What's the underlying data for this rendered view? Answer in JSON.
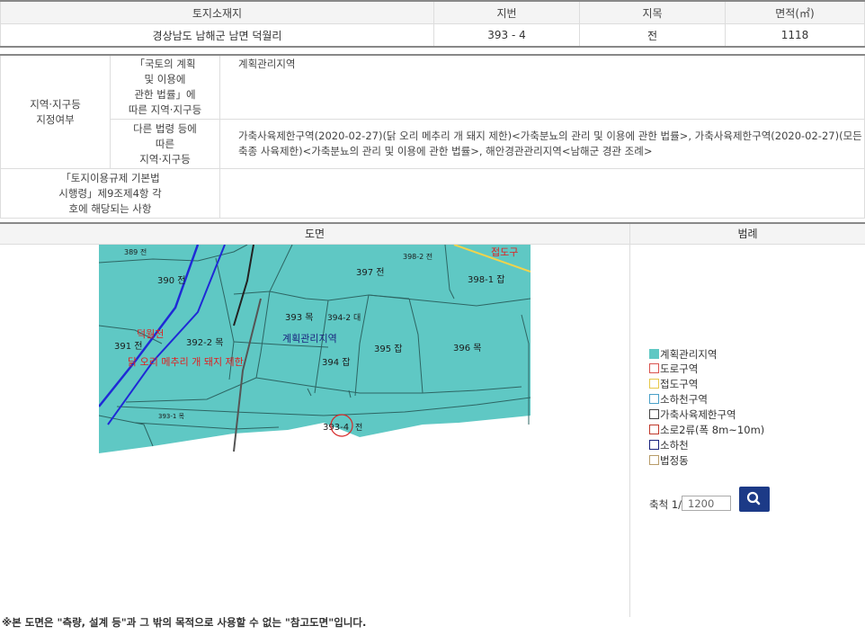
{
  "land_table": {
    "headers": [
      "토지소재지",
      "지번",
      "지목",
      "면적(㎡)"
    ],
    "row": [
      "경상남도 남해군 남면 덕월리",
      "393 - 4",
      "전",
      "1118"
    ]
  },
  "zoning": {
    "section_label": "지역·지구등\n지정여부",
    "national_act_label": "「국토의 계획\n및 이용에\n관한 법률」에\n따른 지역·지구등",
    "national_act_value": "계획관리지역",
    "other_laws_label": "다른 법령 등에\n따른\n지역·지구등",
    "other_laws_value": "가축사육제한구역(2020-02-27)(닭 오리 메추리 개 돼지 제한)<가축분뇨의 관리 및 이용에 관한 법률>, 가축사육제한구역(2020-02-27)(모든축종 사육제한)<가축분뇨의 관리 및 이용에 관한 법률>, 해안경관관리지역<남해군 경관 조례>",
    "decree_label": "「토지이용규제 기본법\n시행령」제9조제4항 각\n호에 해당되는 사항",
    "decree_value": ""
  },
  "map_section": {
    "map_header": "도면",
    "legend_header": "범례",
    "map_labels": {
      "p389": "389 전",
      "p390": "390 전",
      "p397": "397 전",
      "p398_2": "398-2 전",
      "p398_1": "398-1 잡",
      "p393": "393 목",
      "p394_2": "394-2 대",
      "p391": "391 전",
      "p392_2": "392-2 목",
      "p395": "395 잡",
      "p396": "396 목",
      "p394": "394 잡",
      "p393_1": "393-1 목",
      "p393_4": "393-4",
      "p393_4_use": "전",
      "zone": "계획관리지역",
      "stream": "덕월천",
      "restriction": "닭 오리 메추리 개 돼지 제한",
      "road": "접도구"
    },
    "legend_items": [
      {
        "label": "계획관리지역",
        "color": "#5fc8c4",
        "fill": true
      },
      {
        "label": "도로구역",
        "color": "#d9534f",
        "fill": false
      },
      {
        "label": "접도구역",
        "color": "#e6c84a",
        "fill": false
      },
      {
        "label": "소하천구역",
        "color": "#4aa0c8",
        "fill": false
      },
      {
        "label": "가축사육제한구역",
        "color": "#444444",
        "fill": false
      },
      {
        "label": "소로2류(폭 8m~10m)",
        "color": "#c0392b",
        "fill": false
      },
      {
        "label": "소하천",
        "color": "#1a237e",
        "fill": false
      },
      {
        "label": "법정동",
        "color": "#b89c6a",
        "fill": false
      }
    ],
    "scale_label": "축척 1/",
    "scale_value": "1200",
    "search_icon": "search-icon"
  },
  "footer_note": "※본 도면은 \"측량, 설계 등\"과 그 밖의 목적으로 사용할 수 없는 \"참고도면\"입니다."
}
